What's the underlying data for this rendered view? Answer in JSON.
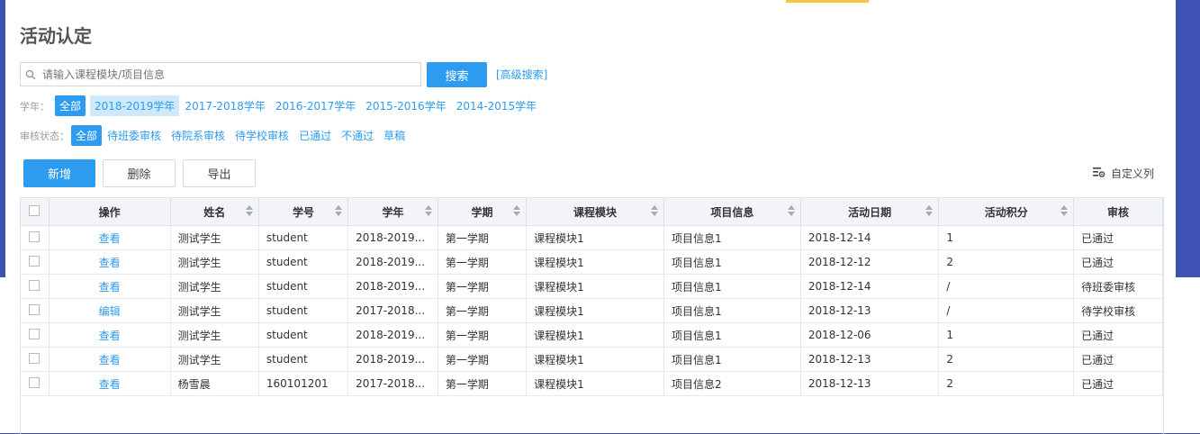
{
  "page": {
    "title": "活动认定"
  },
  "search": {
    "placeholder": "请输入课程模块/项目信息",
    "button_label": "搜索",
    "advanced_label": "[高级搜索]"
  },
  "filters": {
    "year": {
      "label": "学年：",
      "options": [
        "全部",
        "2018-2019学年",
        "2017-2018学年",
        "2016-2017学年",
        "2015-2016学年",
        "2014-2015学年"
      ]
    },
    "status": {
      "label": "审核状态：",
      "options": [
        "全部",
        "待班委审核",
        "待院系审核",
        "待学校审核",
        "已通过",
        "不通过",
        "草稿"
      ]
    }
  },
  "toolbar": {
    "add_label": "新增",
    "delete_label": "删除",
    "export_label": "导出",
    "custom_columns_label": "自定义列"
  },
  "table": {
    "headers": [
      "操作",
      "姓名",
      "学号",
      "学年",
      "学期",
      "课程模块",
      "项目信息",
      "活动日期",
      "活动积分",
      "审核"
    ],
    "rows": [
      [
        "查看",
        "测试学生",
        "student",
        "2018-2019...",
        "第一学期",
        "课程模块1",
        "项目信息1",
        "2018-12-14",
        "1",
        "已通过"
      ],
      [
        "查看",
        "测试学生",
        "student",
        "2018-2019...",
        "第一学期",
        "课程模块1",
        "项目信息1",
        "2018-12-12",
        "2",
        "已通过"
      ],
      [
        "查看",
        "测试学生",
        "student",
        "2018-2019...",
        "第一学期",
        "课程模块1",
        "项目信息1",
        "2018-12-14",
        "/",
        "待班委审核"
      ],
      [
        "编辑",
        "测试学生",
        "student",
        "2017-2018...",
        "第一学期",
        "课程模块1",
        "项目信息1",
        "2018-12-13",
        "/",
        "待学校审核"
      ],
      [
        "查看",
        "测试学生",
        "student",
        "2018-2019...",
        "第一学期",
        "课程模块1",
        "项目信息1",
        "2018-12-06",
        "1",
        "已通过"
      ],
      [
        "查看",
        "测试学生",
        "student",
        "2018-2019...",
        "第一学期",
        "课程模块1",
        "项目信息1",
        "2018-12-13",
        "2",
        "已通过"
      ],
      [
        "查看",
        "杨雪晨",
        "160101201",
        "2017-2018...",
        "第一学期",
        "课程模块1",
        "项目信息2",
        "2018-12-13",
        "2",
        "已通过"
      ]
    ]
  },
  "colors": {
    "accent": "#2c9bf0",
    "background": "#3f51b5"
  }
}
